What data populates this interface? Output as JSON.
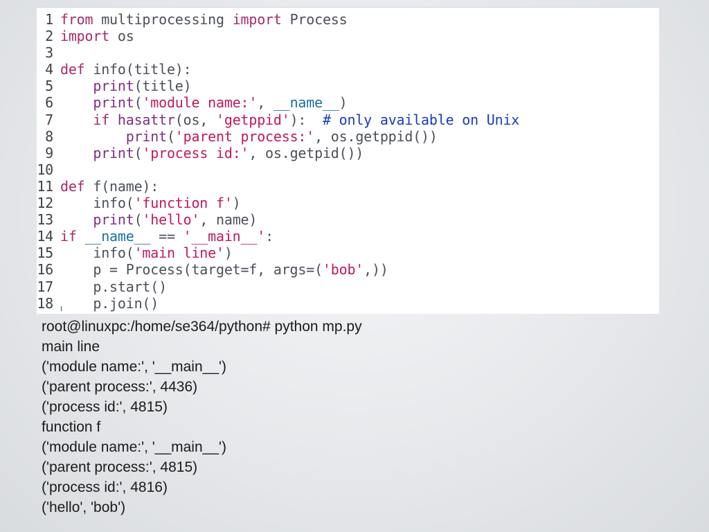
{
  "colors": {
    "keyword": "#a52a6a",
    "builtin": "#7e2d84",
    "string": "#c2185b",
    "dunder": "#1a6fa8",
    "comment": "#1a3bb8",
    "identifier": "#4a4f58"
  },
  "code": {
    "lines": [
      {
        "num": "1",
        "tokens": [
          {
            "t": "from",
            "c": "kw"
          },
          {
            "t": " multiprocessing ",
            "c": "id"
          },
          {
            "t": "import",
            "c": "kw"
          },
          {
            "t": " Process",
            "c": "id"
          }
        ]
      },
      {
        "num": "2",
        "tokens": [
          {
            "t": "import",
            "c": "kw"
          },
          {
            "t": " os",
            "c": "id"
          }
        ]
      },
      {
        "num": "3",
        "tokens": []
      },
      {
        "num": "4",
        "tokens": [
          {
            "t": "def",
            "c": "kw"
          },
          {
            "t": " info(title):",
            "c": "id"
          }
        ]
      },
      {
        "num": "5",
        "tokens": [
          {
            "t": "    ",
            "c": "id"
          },
          {
            "t": "print",
            "c": "bi"
          },
          {
            "t": "(title)",
            "c": "id"
          }
        ]
      },
      {
        "num": "6",
        "tokens": [
          {
            "t": "    ",
            "c": "id"
          },
          {
            "t": "print",
            "c": "bi"
          },
          {
            "t": "(",
            "c": "id"
          },
          {
            "t": "'module name:'",
            "c": "str"
          },
          {
            "t": ", ",
            "c": "id"
          },
          {
            "t": "__name__",
            "c": "dunder"
          },
          {
            "t": ")",
            "c": "id"
          }
        ]
      },
      {
        "num": "7",
        "tokens": [
          {
            "t": "    ",
            "c": "id"
          },
          {
            "t": "if",
            "c": "kw"
          },
          {
            "t": " ",
            "c": "id"
          },
          {
            "t": "hasattr",
            "c": "bi"
          },
          {
            "t": "(os, ",
            "c": "id"
          },
          {
            "t": "'getppid'",
            "c": "str"
          },
          {
            "t": "):  ",
            "c": "id"
          },
          {
            "t": "# only available on Unix",
            "c": "cmt"
          }
        ]
      },
      {
        "num": "8",
        "tokens": [
          {
            "t": "        ",
            "c": "id"
          },
          {
            "t": "print",
            "c": "bi"
          },
          {
            "t": "(",
            "c": "id"
          },
          {
            "t": "'parent process:'",
            "c": "str"
          },
          {
            "t": ", os.getppid())",
            "c": "id"
          }
        ]
      },
      {
        "num": "9",
        "tokens": [
          {
            "t": "    ",
            "c": "id"
          },
          {
            "t": "print",
            "c": "bi"
          },
          {
            "t": "(",
            "c": "id"
          },
          {
            "t": "'process id:'",
            "c": "str"
          },
          {
            "t": ", os.getpid())",
            "c": "id"
          }
        ]
      },
      {
        "num": "10",
        "tokens": []
      },
      {
        "num": "11",
        "tokens": [
          {
            "t": "def",
            "c": "kw"
          },
          {
            "t": " f(name):",
            "c": "id"
          }
        ]
      },
      {
        "num": "12",
        "tokens": [
          {
            "t": "    info(",
            "c": "id"
          },
          {
            "t": "'function f'",
            "c": "str"
          },
          {
            "t": ")",
            "c": "id"
          }
        ]
      },
      {
        "num": "13",
        "tokens": [
          {
            "t": "    ",
            "c": "id"
          },
          {
            "t": "print",
            "c": "bi"
          },
          {
            "t": "(",
            "c": "id"
          },
          {
            "t": "'hello'",
            "c": "str"
          },
          {
            "t": ", name)",
            "c": "id"
          }
        ]
      },
      {
        "num": "14",
        "tokens": [
          {
            "t": "if",
            "c": "kw"
          },
          {
            "t": " ",
            "c": "id"
          },
          {
            "t": "__name__",
            "c": "dunder"
          },
          {
            "t": " == ",
            "c": "id"
          },
          {
            "t": "'__main__'",
            "c": "str"
          },
          {
            "t": ":",
            "c": "id"
          }
        ]
      },
      {
        "num": "15",
        "tokens": [
          {
            "t": "    info(",
            "c": "id"
          },
          {
            "t": "'main line'",
            "c": "str"
          },
          {
            "t": ")",
            "c": "id"
          }
        ]
      },
      {
        "num": "16",
        "tokens": [
          {
            "t": "    p = Process(target=f, args=(",
            "c": "id"
          },
          {
            "t": "'bob'",
            "c": "str"
          },
          {
            "t": ",))",
            "c": "id"
          }
        ]
      },
      {
        "num": "17",
        "tokens": [
          {
            "t": "    p.start()",
            "c": "id"
          }
        ]
      },
      {
        "num": "18",
        "tokens": [
          {
            "t": "    p.join()",
            "c": "id"
          }
        ]
      }
    ]
  },
  "terminal": {
    "lines": [
      "root@linuxpc:/home/se364/python# python mp.py",
      "main line",
      "('module name:', '__main__')",
      "('parent process:', 4436)",
      "('process id:', 4815)",
      "function f",
      "('module name:', '__main__')",
      "('parent process:', 4815)",
      "('process id:', 4816)",
      "('hello', 'bob')"
    ]
  }
}
